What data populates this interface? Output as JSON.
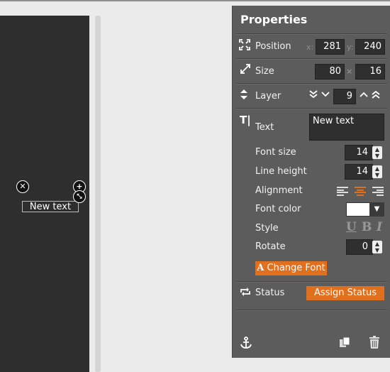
{
  "canvas": {
    "selected_text": "New text"
  },
  "panel": {
    "title": "Properties",
    "position": {
      "label": "Position",
      "x_label": "x:",
      "x": "281",
      "y_label": "y:",
      "y": "240"
    },
    "size": {
      "label": "Size",
      "w": "80",
      "sep": "×",
      "h": "16"
    },
    "layer": {
      "label": "Layer",
      "value": "9"
    },
    "text": {
      "label": "Text",
      "value": "New text"
    },
    "font_size": {
      "label": "Font size",
      "value": "14"
    },
    "line_height": {
      "label": "Line height",
      "value": "14"
    },
    "alignment": {
      "label": "Alignment",
      "options": [
        "left",
        "center",
        "right"
      ],
      "selected": "center"
    },
    "font_color": {
      "label": "Font color",
      "value": "#ffffff"
    },
    "style": {
      "label": "Style",
      "underline": "U",
      "bold": "B",
      "italic": "I"
    },
    "rotate": {
      "label": "Rotate",
      "value": "0"
    },
    "change_font": {
      "icon": "A",
      "label": "Change Font"
    },
    "status": {
      "label": "Status",
      "button": "Assign Status"
    }
  },
  "colors": {
    "accent": "#e0701e",
    "panel_bg": "#5c5c5c",
    "canvas_bg": "#2e2e2e"
  }
}
